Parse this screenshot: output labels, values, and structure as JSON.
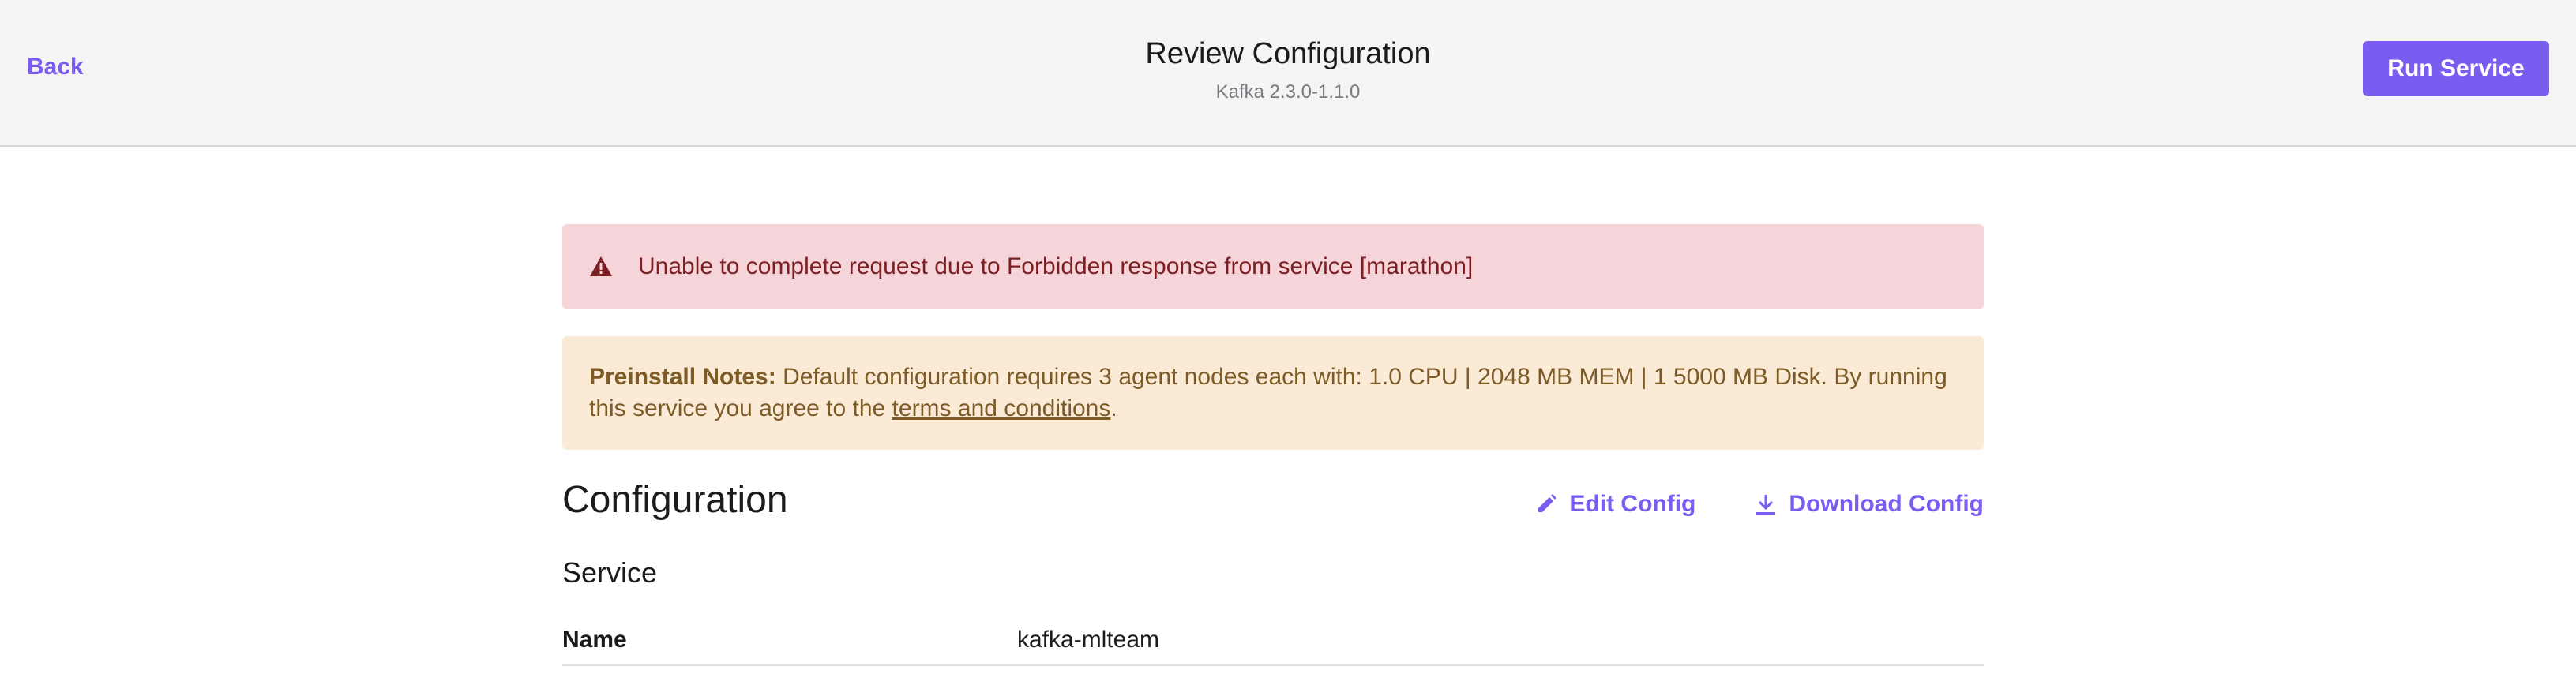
{
  "header": {
    "back_label": "Back",
    "title": "Review Configuration",
    "subtitle": "Kafka 2.3.0-1.1.0",
    "run_label": "Run Service"
  },
  "alerts": {
    "error_text": "Unable to complete request due to Forbidden response from service [marathon]",
    "error_icon": "warning-triangle-icon",
    "notes_label": "Preinstall Notes:",
    "notes_text": " Default configuration requires 3 agent nodes each with: 1.0 CPU | 2048 MB MEM | 1 5000 MB Disk. By running this service you agree to the ",
    "notes_link": "terms and conditions",
    "notes_end": "."
  },
  "configuration": {
    "heading": "Configuration",
    "edit_label": "Edit Config",
    "download_label": "Download Config",
    "section": "Service",
    "fields": [
      {
        "label": "Name",
        "value": "kafka-mlteam"
      }
    ]
  },
  "colors": {
    "accent": "#7b5cf0",
    "error_bg": "#f5d5d9",
    "error_text": "#7c1e22",
    "warning_bg": "#fbebd6",
    "warning_text": "#7d5b27"
  }
}
